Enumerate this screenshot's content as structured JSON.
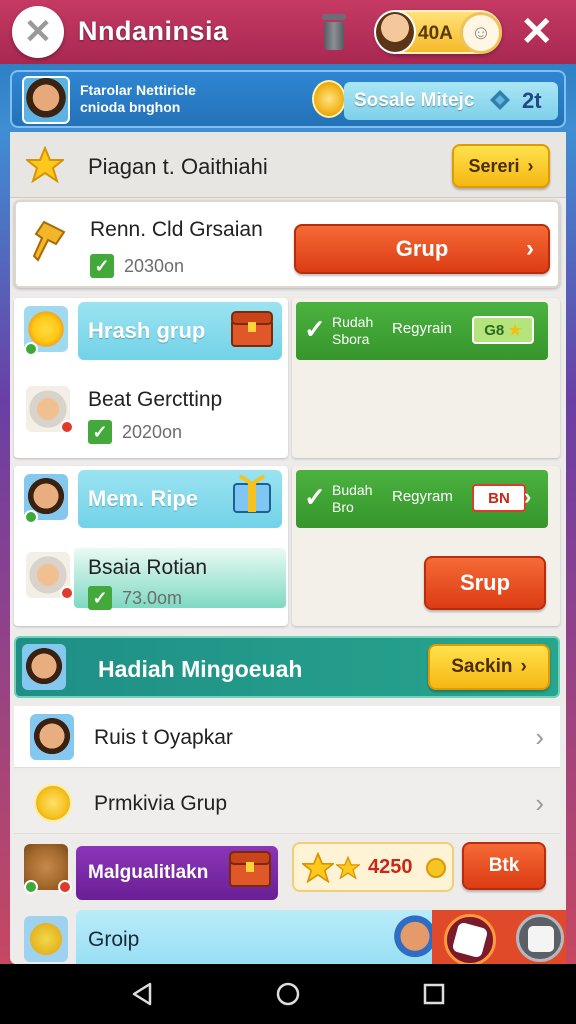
{
  "topbar": {
    "close_symbol": "✕",
    "title": "Nndaninsia",
    "coin_value": "40A",
    "close_symbol_right": "✕"
  },
  "profile": {
    "line1": "Ftarolar Nettiricle",
    "line2": "cnioda bnghon",
    "achievement": "Sosale Mitejc",
    "level": "2t"
  },
  "header": {
    "title": "Piagan  t. Oaithiahi",
    "button": "Sereri"
  },
  "quest_card": {
    "title": "Renn. Cld Grsaian",
    "sub": "2030on",
    "button": "Grup"
  },
  "rows": [
    {
      "pill": "Hrash grup",
      "name": "Beat Gercttinp",
      "sub": "2020on",
      "banner_l1": "Rudah",
      "banner_l2": "Sbora",
      "banner_l3": "Regyrain",
      "tag": "G8"
    },
    {
      "pill": "Mem. Ripe",
      "name": "Bsaia Rotian",
      "sub": "73.0om",
      "banner_l1": "Budah",
      "banner_l2": "Bro",
      "banner_l3": "Regyram",
      "tag": "BN",
      "button": "Srup"
    }
  ],
  "teal_banner": {
    "title": "Hadiah Mingoeuah",
    "button": "Sackin"
  },
  "list": [
    {
      "label": "Ruis t Oyapkar"
    },
    {
      "label": "Prmkivia Grup"
    }
  ],
  "purple": {
    "label": "Malgualitlakn"
  },
  "stars": {
    "value": "4250"
  },
  "back_button": "Btk",
  "bottom": {
    "label": "Groip"
  },
  "colors": {
    "accent_red": "#c53a63",
    "accent_orange": "#dc3c14",
    "accent_yellow": "#f5b714",
    "accent_green": "#43a93b",
    "accent_teal": "#1f8f86"
  }
}
